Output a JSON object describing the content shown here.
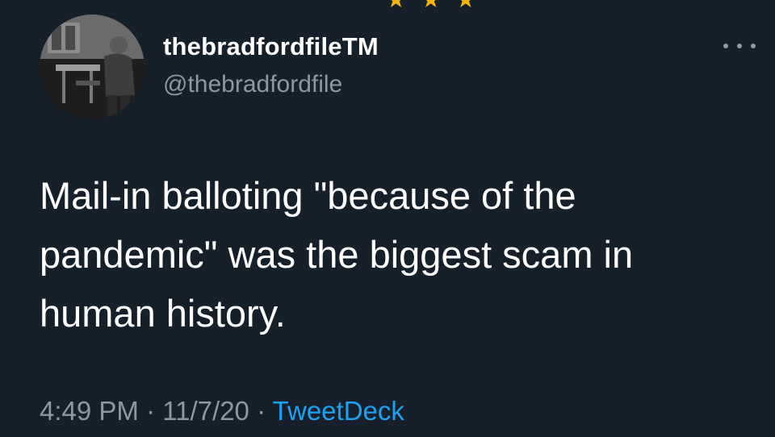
{
  "user": {
    "display_name": "thebradfordfileTM",
    "handle": "@thebradfordfile",
    "avatar_icon": "profile-photo"
  },
  "tweet": {
    "text_lines": [
      "Mail-in balloting \"because of the",
      "pandemic\" was the biggest scam in",
      "human history."
    ],
    "time": "4:49 PM",
    "separator": "·",
    "date": "11/7/20",
    "source": "TweetDeck"
  },
  "more_icon": "more-horizontal-icon",
  "colors": {
    "background": "#15202b",
    "primary_text": "#ffffff",
    "secondary_text": "#8899a6",
    "link": "#1da1f2"
  }
}
